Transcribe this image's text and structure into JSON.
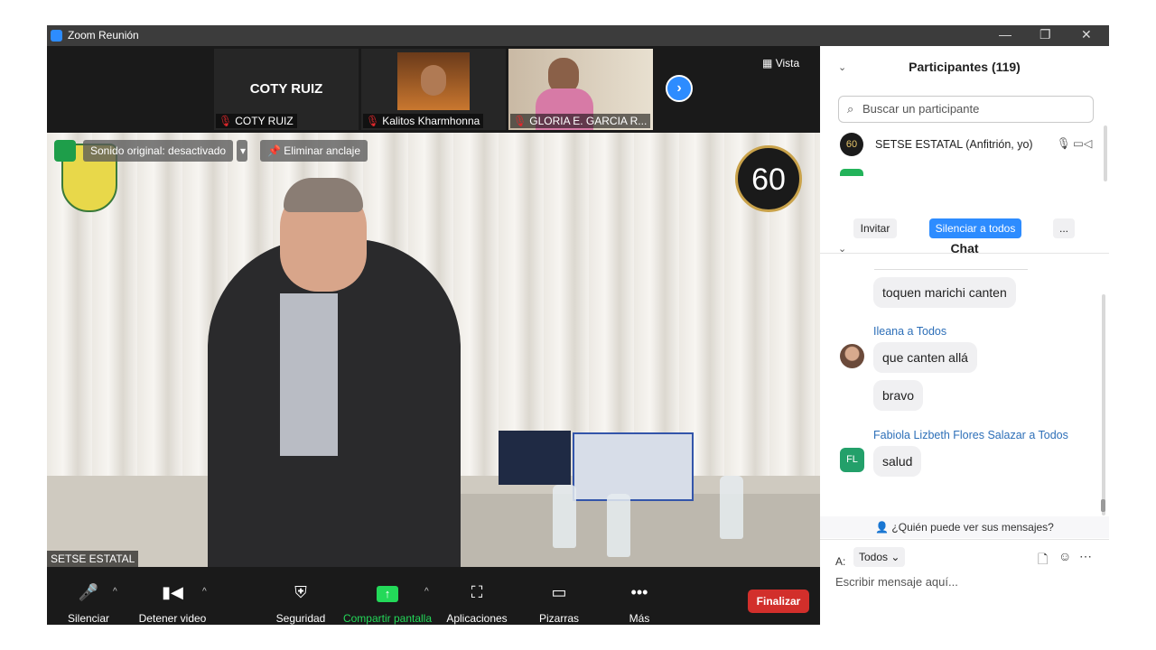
{
  "window": {
    "title": "Zoom Reunión",
    "minimize": "—",
    "maximize": "❐",
    "close": "✕"
  },
  "strip": {
    "thumbs": [
      {
        "big": "COTY RUIZ",
        "name": "COTY RUIZ"
      },
      {
        "big": "",
        "name": "Kalitos Kharmhonna"
      },
      {
        "big": "",
        "name": "GLORIA E. GARCIA R..."
      }
    ],
    "vista": "Vista"
  },
  "video": {
    "sound_button": "Sonido original: desactivado",
    "unpin_button": "Eliminar anclaje",
    "logo_60": "60",
    "speaker_label": "SETSE ESTATAL"
  },
  "toolbar": {
    "mute": "Silenciar",
    "stop_video": "Detener video",
    "security": "Seguridad",
    "share": "Compartir pantalla",
    "apps": "Aplicaciones",
    "whiteboards": "Pizarras",
    "more": "Más",
    "end": "Finalizar"
  },
  "participants": {
    "header": "Participantes (119)",
    "search_placeholder": "Buscar un participante",
    "rows": [
      {
        "avatar": "60",
        "name": "SETSE ESTATAL (Anfitrión, yo)"
      }
    ],
    "invite": "Invitar",
    "mute_all": "Silenciar a todos",
    "more": "..."
  },
  "chat": {
    "header": "Chat",
    "messages": [
      {
        "text": "toquen marichi canten"
      },
      {
        "sender": "Ileana",
        "to": "a Todos",
        "text": "que canten allá"
      },
      {
        "text": "bravo"
      },
      {
        "sender": "Fabiola Lizbeth Flores Salazar",
        "to": "a Todos",
        "initials": "FL",
        "text": "salud"
      }
    ],
    "who_can_see": "¿Quién puede ver sus mensajes?",
    "to_label": "A:",
    "to_value": "Todos",
    "input_placeholder": "Escribir mensaje aquí..."
  },
  "colors": {
    "accent": "#2d8cff",
    "end": "#d22f2b",
    "share": "#23d959",
    "link": "#2d6fb8"
  }
}
